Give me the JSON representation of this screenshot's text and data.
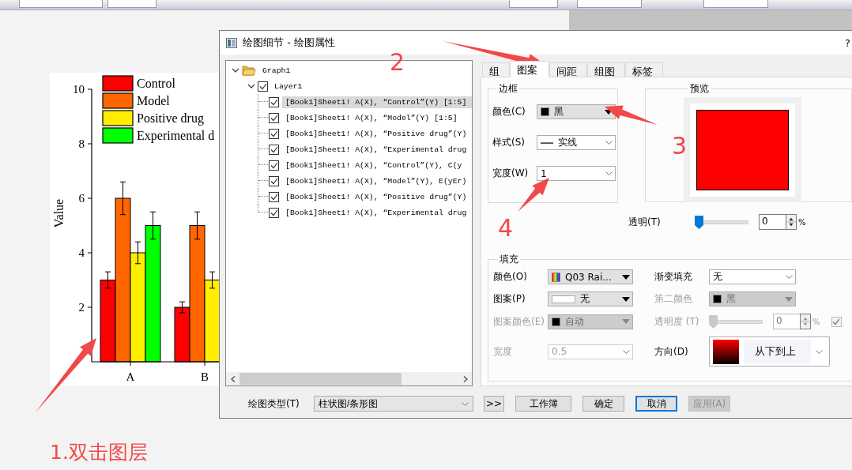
{
  "graph": {
    "chart_data": {
      "type": "bar",
      "legend": "upper left",
      "ylabel": "Value",
      "categories": [
        "A",
        "B"
      ],
      "ylim": [
        0,
        10
      ],
      "yticks": [
        2,
        4,
        6,
        8,
        10
      ],
      "series": [
        {
          "name": "Control",
          "color": "#ff0000",
          "values": [
            3,
            2
          ],
          "errors": [
            0.3,
            0.2
          ]
        },
        {
          "name": "Model",
          "color": "#ff6600",
          "values": [
            6,
            5
          ],
          "errors": [
            0.6,
            0.5
          ]
        },
        {
          "name": "Positive drug",
          "color": "#ffee00",
          "values": [
            4,
            3
          ],
          "errors": [
            0.4,
            0.3
          ]
        },
        {
          "name": "Experimental d",
          "color": "#00ff00",
          "values": [
            5,
            null
          ],
          "errors": [
            0.5,
            null
          ]
        }
      ]
    }
  },
  "dialog": {
    "title": "绘图细节 - 绘图属性",
    "help": "?",
    "tree": [
      {
        "label": "Graph1",
        "expanded": true,
        "children": [
          {
            "label": "Layer1",
            "expanded": true,
            "checked": true,
            "children": [
              {
                "label": "[Book1]Sheet1! A(X), “Control”(Y) [1:5]",
                "checked": true,
                "selected": true
              },
              {
                "label": "[Book1]Sheet1! A(X), “Model”(Y) [1:5]",
                "checked": true,
                "selected": false
              },
              {
                "label": "[Book1]Sheet1! A(X), “Positive drug”(Y)",
                "checked": true,
                "selected": false
              },
              {
                "label": "[Book1]Sheet1! A(X), “Experimental drug",
                "checked": true,
                "selected": false
              },
              {
                "label": "[Book1]Sheet1! A(X), “Control”(Y), C(y",
                "checked": true,
                "selected": false
              },
              {
                "label": "[Book1]Sheet1! A(X), “Model”(Y), E(yEr)",
                "checked": true,
                "selected": false
              },
              {
                "label": "[Book1]Sheet1! A(X), “Positive drug”(Y)",
                "checked": true,
                "selected": false
              },
              {
                "label": "[Book1]Sheet1! A(X), “Experimental drug",
                "checked": true,
                "selected": false
              }
            ]
          }
        ]
      }
    ],
    "tabs": [
      {
        "label": "组",
        "selected": false
      },
      {
        "label": "图案",
        "selected": true
      },
      {
        "label": "间距",
        "selected": false
      },
      {
        "label": "组图",
        "selected": false
      },
      {
        "label": "标签",
        "selected": false
      }
    ],
    "border": {
      "title": "边框",
      "rows": [
        {
          "label": "颜色(C)",
          "kind": "color",
          "value": "黑",
          "color": "#000000"
        },
        {
          "label": "样式(S)",
          "kind": "line",
          "value": "实线"
        },
        {
          "label": "宽度(W)",
          "kind": "plain",
          "value": "1"
        }
      ]
    },
    "preview": {
      "title": "预览",
      "color": "#ff0000"
    },
    "transparency": {
      "label": "透明(T)",
      "kind": "slider",
      "level": 0,
      "value": "0",
      "unit": "%"
    },
    "fill": {
      "title": "填充",
      "left": [
        {
          "label": "颜色(O)",
          "kind": "rainbow",
          "value": "Q03 Rai...",
          "disabled": false
        },
        {
          "label": "图案(P)",
          "kind": "pattern",
          "value": "无",
          "disabled": false
        },
        {
          "label": "图案颜色(E)",
          "kind": "color",
          "value": "自动",
          "color": "#000000",
          "disabled": true
        },
        {
          "label": "宽度",
          "kind": "plain",
          "value": "0.5",
          "disabled": true
        }
      ],
      "right": [
        {
          "label": "渐变填充",
          "kind": "plain",
          "value": "无",
          "disabled": false
        },
        {
          "label": "第二颜色",
          "kind": "color",
          "value": "黑",
          "color": "#000000",
          "disabled": true
        },
        {
          "label": "透明度 (T)",
          "kind": "slider",
          "level": 0,
          "value": "0",
          "unit": "%",
          "checked": true,
          "disabled": true
        },
        {
          "label": "方向(D)",
          "kind": "gradient",
          "value": "从下到上",
          "disabled": false
        }
      ]
    },
    "footer": {
      "label": "绘图类型(T)",
      "plot_type": "柱状图/条形图",
      "buttons": [
        {
          "label": ">>",
          "focused": false,
          "disabled": false
        },
        {
          "label": "工作簿",
          "focused": false,
          "disabled": false
        },
        {
          "label": "确定",
          "focused": false,
          "disabled": false
        },
        {
          "label": "取消",
          "focused": true,
          "disabled": false
        },
        {
          "label": "应用(A)",
          "focused": false,
          "disabled": true
        }
      ]
    }
  },
  "annotations": [
    {
      "text": "2"
    },
    {
      "text": "3"
    },
    {
      "text": "4"
    },
    {
      "text": "1.双击图层"
    }
  ]
}
